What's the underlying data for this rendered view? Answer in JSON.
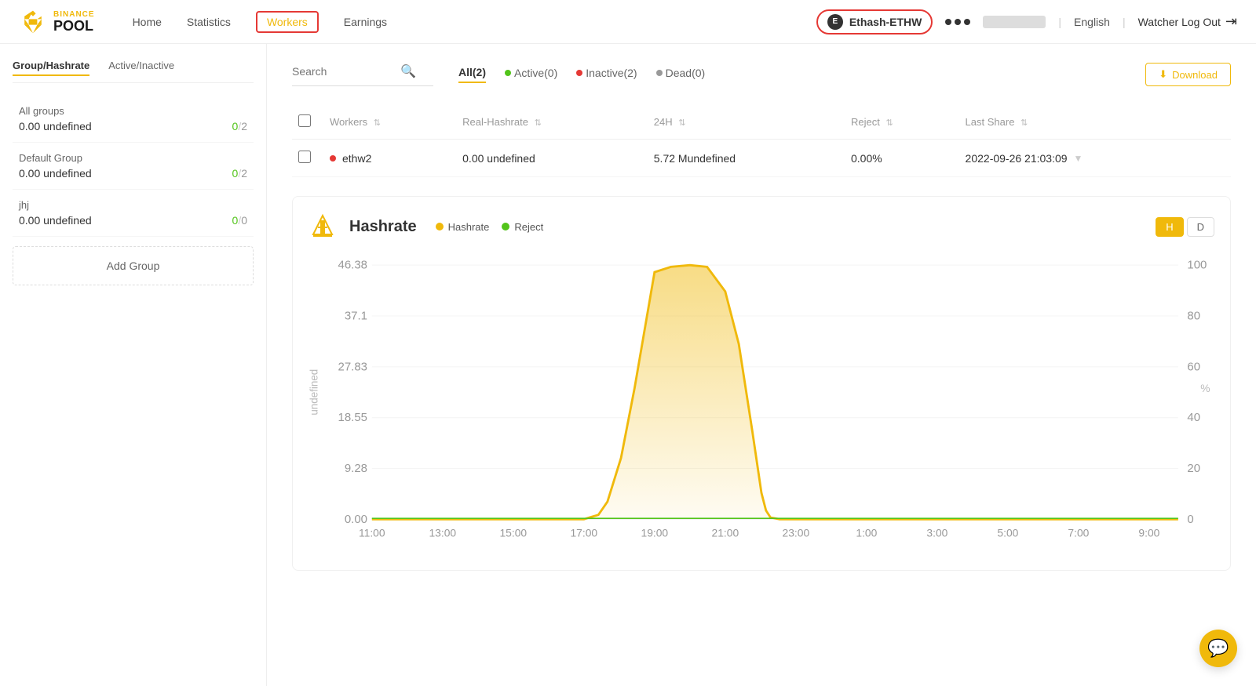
{
  "logo": {
    "binance_text": "BINANCE",
    "pool_text": "POOL"
  },
  "navbar": {
    "links": [
      {
        "id": "home",
        "label": "Home",
        "active": false
      },
      {
        "id": "statistics",
        "label": "Statistics",
        "active": false
      },
      {
        "id": "workers",
        "label": "Workers",
        "active": true
      },
      {
        "id": "earnings",
        "label": "Earnings",
        "active": false
      }
    ],
    "coin_selector": {
      "name": "Ethash-ETHW"
    },
    "language": "English",
    "logout_label": "Watcher Log Out"
  },
  "sidebar": {
    "tab1": "Group/Hashrate",
    "tab2": "Active/Inactive",
    "groups": [
      {
        "name": "All groups",
        "hashrate": "0.00 undefined",
        "active": "0",
        "total": "2"
      },
      {
        "name": "Default Group",
        "hashrate": "0.00 undefined",
        "active": "0",
        "total": "2"
      },
      {
        "name": "jhj",
        "hashrate": "0.00 undefined",
        "active": "0",
        "total": "0"
      }
    ],
    "add_group_label": "Add Group"
  },
  "filter_bar": {
    "search_placeholder": "Search",
    "tabs": [
      {
        "id": "all",
        "label": "All(2)",
        "active": true,
        "dot": null
      },
      {
        "id": "active",
        "label": "Active(0)",
        "active": false,
        "dot": "active"
      },
      {
        "id": "inactive",
        "label": "Inactive(2)",
        "active": false,
        "dot": "inactive"
      },
      {
        "id": "dead",
        "label": "Dead(0)",
        "active": false,
        "dot": "dead"
      }
    ],
    "download_label": "Download"
  },
  "table": {
    "columns": [
      {
        "id": "workers",
        "label": "Workers"
      },
      {
        "id": "real_hashrate",
        "label": "Real-Hashrate"
      },
      {
        "id": "24h",
        "label": "24H"
      },
      {
        "id": "reject",
        "label": "Reject"
      },
      {
        "id": "last_share",
        "label": "Last Share"
      }
    ],
    "rows": [
      {
        "name": "ethw2",
        "status": "inactive",
        "real_hashrate": "0.00 undefined",
        "h24": "5.72 Mundefined",
        "reject": "0.00%",
        "last_share": "2022-09-26 21:03:09"
      }
    ]
  },
  "chart": {
    "title": "Hashrate",
    "legend": {
      "hashrate": "Hashrate",
      "reject": "Reject"
    },
    "period_buttons": [
      {
        "label": "H",
        "active": true
      },
      {
        "label": "D",
        "active": false
      }
    ],
    "y_axis_left": [
      "46.38",
      "37.1",
      "27.83",
      "18.55",
      "9.28",
      "0.00"
    ],
    "y_axis_label_left": "undefined",
    "y_axis_right": [
      "100",
      "80",
      "60",
      "40",
      "20",
      "0"
    ],
    "y_axis_label_right": "%",
    "x_axis": [
      "11:00",
      "13:00",
      "15:00",
      "17:00",
      "19:00",
      "21:00",
      "23:00",
      "1:00",
      "3:00",
      "5:00",
      "7:00",
      "9:00"
    ]
  },
  "chat_fab": {
    "icon": "💬"
  }
}
